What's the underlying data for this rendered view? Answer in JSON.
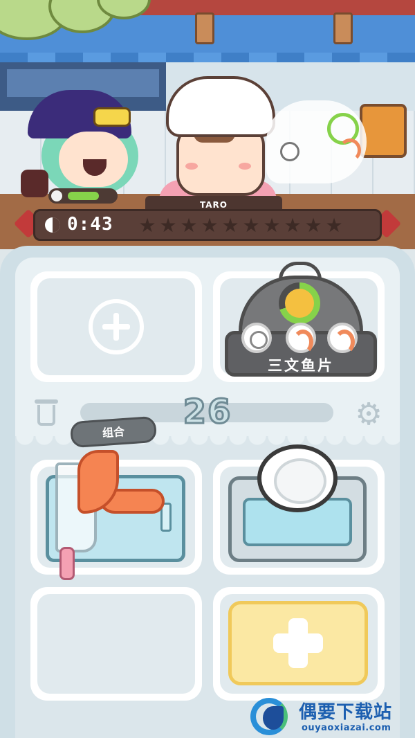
{
  "customer": {
    "name": "TARO",
    "mood_fraction": 0.68
  },
  "hud": {
    "time_left": "0:43",
    "stars_total": 10,
    "stars_earned": 0
  },
  "order": {
    "dish_name": "三文鱼片",
    "ingredients": [
      "plate-icon",
      "shrimp-icon",
      "shrimp-icon"
    ],
    "cook_progress": 0.7
  },
  "controls": {
    "score": "26",
    "combine_label": "组合"
  },
  "stations": {
    "cutting": "salmon-on-board",
    "dish": "plate-on-sink"
  },
  "watermark": {
    "site_name": "偶要下载站",
    "url": "ouyaoxiazai.com"
  },
  "colors": {
    "accent_green": "#86d24a",
    "hud_brown": "#5a3f38",
    "salmon": "#f58452",
    "add_yellow": "#fbe8a3",
    "watermark_blue": "#1c5fb0"
  }
}
